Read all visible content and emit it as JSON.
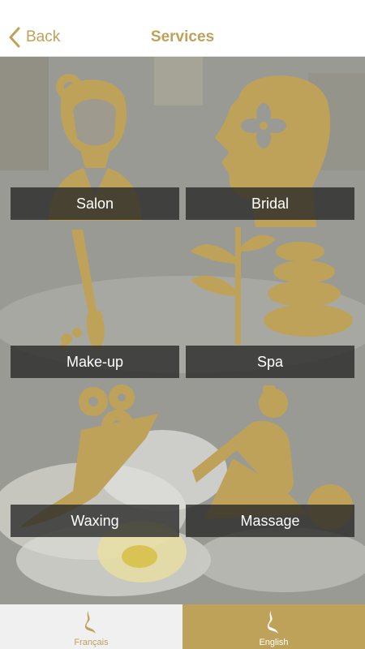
{
  "nav": {
    "back_label": "Back",
    "title": "Services"
  },
  "services": [
    {
      "label": "Salon",
      "icon": "woman-with-flower-icon"
    },
    {
      "label": "Bridal",
      "icon": "head-profile-flower-icon"
    },
    {
      "label": "Make-up",
      "icon": "makeup-brush-icon"
    },
    {
      "label": "Spa",
      "icon": "spa-stones-bamboo-icon"
    },
    {
      "label": "Waxing",
      "icon": "leg-flowers-icon"
    },
    {
      "label": "Massage",
      "icon": "massage-person-icon"
    }
  ],
  "tabs": [
    {
      "label": "Français",
      "icon": "brand-logo-icon"
    },
    {
      "label": "English",
      "icon": "brand-logo-icon",
      "selected": true
    }
  ],
  "colors": {
    "accent": "#BFA25A",
    "label_bg": "#262626",
    "tab_inactive_bg": "#F0F0F0"
  }
}
